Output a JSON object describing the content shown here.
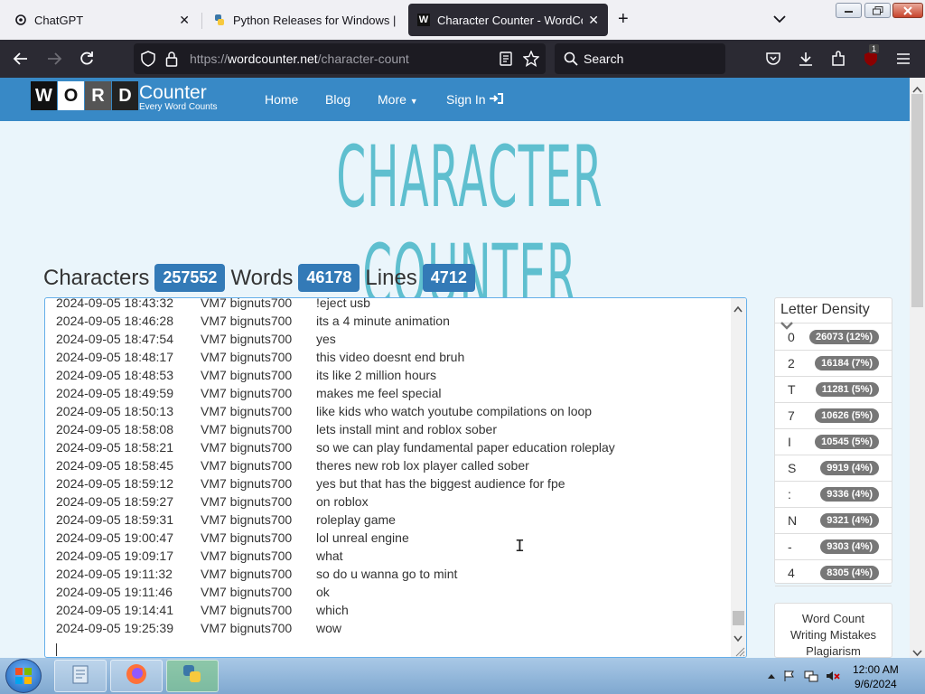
{
  "tabs": [
    {
      "label": "ChatGPT",
      "icon": "chatgpt-icon"
    },
    {
      "label": "Python Releases for Windows | Python",
      "icon": "python-icon"
    },
    {
      "label": "Character Counter - WordCounter",
      "icon": "w-icon",
      "favicon_letter": "W"
    }
  ],
  "toolbar": {
    "url_prefix": "https://",
    "url_host": "wordcounter.net",
    "url_path": "/character-count",
    "search_placeholder": "Search",
    "ext_badge": "1"
  },
  "site": {
    "logo_letters": [
      "W",
      "O",
      "R",
      "D"
    ],
    "logo_main": "Counter",
    "logo_sub": "Every Word Counts",
    "nav": {
      "home": "Home",
      "blog": "Blog",
      "more": "More",
      "signin": "Sign In"
    }
  },
  "page": {
    "title": "CHARACTER COUNTER",
    "stats": {
      "characters_label": "Characters",
      "characters": "257552",
      "words_label": "Words",
      "words": "46178",
      "lines_label": "Lines",
      "lines": "4712"
    }
  },
  "editor": {
    "rows": [
      {
        "time": "2024-09-05 18:43:32",
        "user": "VM7 bignuts700",
        "msg": "!eject usb"
      },
      {
        "time": "2024-09-05 18:46:28",
        "user": "VM7 bignuts700",
        "msg": "its a 4 minute animation"
      },
      {
        "time": "2024-09-05 18:47:54",
        "user": "VM7 bignuts700",
        "msg": "yes"
      },
      {
        "time": "2024-09-05 18:48:17",
        "user": "VM7 bignuts700",
        "msg": "this video doesnt end bruh"
      },
      {
        "time": "2024-09-05 18:48:53",
        "user": "VM7 bignuts700",
        "msg": "its like 2 million hours"
      },
      {
        "time": "2024-09-05 18:49:59",
        "user": "VM7 bignuts700",
        "msg": "makes me feel special"
      },
      {
        "time": "2024-09-05 18:50:13",
        "user": "VM7 bignuts700",
        "msg": "like kids who watch youtube compilations on loop"
      },
      {
        "time": "2024-09-05 18:58:08",
        "user": "VM7 bignuts700",
        "msg": "lets install mint and roblox sober"
      },
      {
        "time": "2024-09-05 18:58:21",
        "user": "VM7 bignuts700",
        "msg": "so we can play fundamental paper education roleplay"
      },
      {
        "time": "2024-09-05 18:58:45",
        "user": "VM7 bignuts700",
        "msg": "theres new rob lox player called sober"
      },
      {
        "time": "2024-09-05 18:59:12",
        "user": "VM7 bignuts700",
        "msg": "yes but that has the biggest audience for fpe"
      },
      {
        "time": "2024-09-05 18:59:27",
        "user": "VM7 bignuts700",
        "msg": "on roblox"
      },
      {
        "time": "2024-09-05 18:59:31",
        "user": "VM7 bignuts700",
        "msg": "roleplay game"
      },
      {
        "time": "2024-09-05 19:00:47",
        "user": "VM7 bignuts700",
        "msg": "lol unreal engine"
      },
      {
        "time": "2024-09-05 19:09:17",
        "user": "VM7 bignuts700",
        "msg": "what"
      },
      {
        "time": "2024-09-05 19:11:32",
        "user": "VM7 bignuts700",
        "msg": "so do u wanna go to mint"
      },
      {
        "time": "2024-09-05 19:11:46",
        "user": "VM7 bignuts700",
        "msg": "ok"
      },
      {
        "time": "2024-09-05 19:14:41",
        "user": "VM7 bignuts700",
        "msg": "which"
      },
      {
        "time": "2024-09-05 19:25:39",
        "user": "VM7 bignuts700",
        "msg": "wow"
      }
    ]
  },
  "density": {
    "title": "Letter Density",
    "items": [
      {
        "char": "0",
        "value": "26073 (12%)"
      },
      {
        "char": "2",
        "value": "16184 (7%)"
      },
      {
        "char": "T",
        "value": "11281 (5%)"
      },
      {
        "char": "7",
        "value": "10626 (5%)"
      },
      {
        "char": "I",
        "value": "10545 (5%)"
      },
      {
        "char": "S",
        "value": "9919 (4%)"
      },
      {
        "char": ":",
        "value": "9336 (4%)"
      },
      {
        "char": "N",
        "value": "9321 (4%)"
      },
      {
        "char": "-",
        "value": "9303 (4%)"
      },
      {
        "char": "4",
        "value": "8305 (4%)"
      }
    ]
  },
  "sidebar_links": [
    "Word Count",
    "Writing Mistakes",
    "Plagiarism"
  ],
  "taskbar": {
    "time": "12:00 AM",
    "date": "9/6/2024"
  },
  "colors": {
    "brand_blue": "#3889c6",
    "title_teal": "#5fbfcf",
    "badge_blue": "#337ab7",
    "density_gray": "#777777"
  }
}
